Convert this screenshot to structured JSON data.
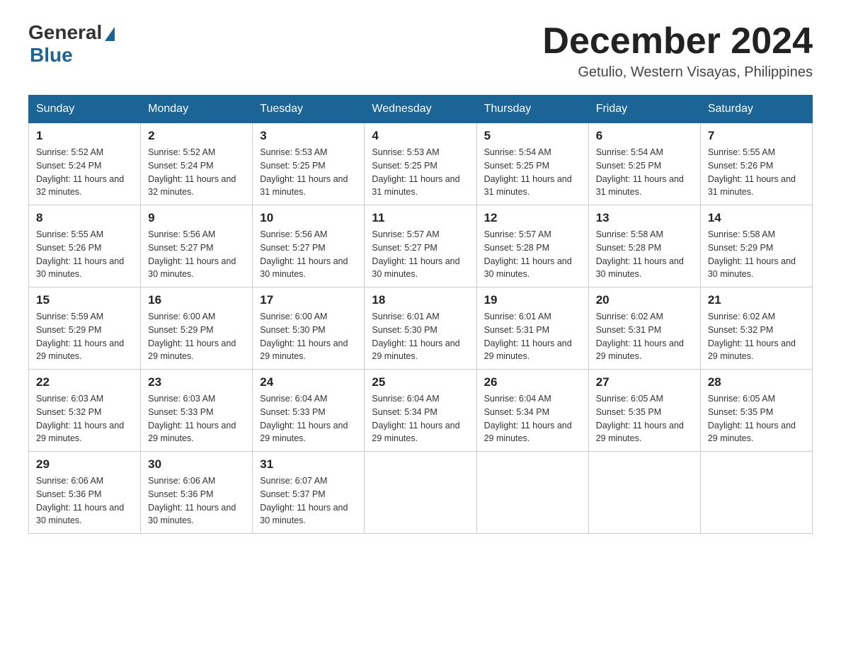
{
  "logo": {
    "general": "General",
    "blue": "Blue"
  },
  "header": {
    "month_year": "December 2024",
    "location": "Getulio, Western Visayas, Philippines"
  },
  "days_of_week": [
    "Sunday",
    "Monday",
    "Tuesday",
    "Wednesday",
    "Thursday",
    "Friday",
    "Saturday"
  ],
  "weeks": [
    [
      {
        "day": "1",
        "sunrise": "5:52 AM",
        "sunset": "5:24 PM",
        "daylight": "11 hours and 32 minutes."
      },
      {
        "day": "2",
        "sunrise": "5:52 AM",
        "sunset": "5:24 PM",
        "daylight": "11 hours and 32 minutes."
      },
      {
        "day": "3",
        "sunrise": "5:53 AM",
        "sunset": "5:25 PM",
        "daylight": "11 hours and 31 minutes."
      },
      {
        "day": "4",
        "sunrise": "5:53 AM",
        "sunset": "5:25 PM",
        "daylight": "11 hours and 31 minutes."
      },
      {
        "day": "5",
        "sunrise": "5:54 AM",
        "sunset": "5:25 PM",
        "daylight": "11 hours and 31 minutes."
      },
      {
        "day": "6",
        "sunrise": "5:54 AM",
        "sunset": "5:25 PM",
        "daylight": "11 hours and 31 minutes."
      },
      {
        "day": "7",
        "sunrise": "5:55 AM",
        "sunset": "5:26 PM",
        "daylight": "11 hours and 31 minutes."
      }
    ],
    [
      {
        "day": "8",
        "sunrise": "5:55 AM",
        "sunset": "5:26 PM",
        "daylight": "11 hours and 30 minutes."
      },
      {
        "day": "9",
        "sunrise": "5:56 AM",
        "sunset": "5:27 PM",
        "daylight": "11 hours and 30 minutes."
      },
      {
        "day": "10",
        "sunrise": "5:56 AM",
        "sunset": "5:27 PM",
        "daylight": "11 hours and 30 minutes."
      },
      {
        "day": "11",
        "sunrise": "5:57 AM",
        "sunset": "5:27 PM",
        "daylight": "11 hours and 30 minutes."
      },
      {
        "day": "12",
        "sunrise": "5:57 AM",
        "sunset": "5:28 PM",
        "daylight": "11 hours and 30 minutes."
      },
      {
        "day": "13",
        "sunrise": "5:58 AM",
        "sunset": "5:28 PM",
        "daylight": "11 hours and 30 minutes."
      },
      {
        "day": "14",
        "sunrise": "5:58 AM",
        "sunset": "5:29 PM",
        "daylight": "11 hours and 30 minutes."
      }
    ],
    [
      {
        "day": "15",
        "sunrise": "5:59 AM",
        "sunset": "5:29 PM",
        "daylight": "11 hours and 29 minutes."
      },
      {
        "day": "16",
        "sunrise": "6:00 AM",
        "sunset": "5:29 PM",
        "daylight": "11 hours and 29 minutes."
      },
      {
        "day": "17",
        "sunrise": "6:00 AM",
        "sunset": "5:30 PM",
        "daylight": "11 hours and 29 minutes."
      },
      {
        "day": "18",
        "sunrise": "6:01 AM",
        "sunset": "5:30 PM",
        "daylight": "11 hours and 29 minutes."
      },
      {
        "day": "19",
        "sunrise": "6:01 AM",
        "sunset": "5:31 PM",
        "daylight": "11 hours and 29 minutes."
      },
      {
        "day": "20",
        "sunrise": "6:02 AM",
        "sunset": "5:31 PM",
        "daylight": "11 hours and 29 minutes."
      },
      {
        "day": "21",
        "sunrise": "6:02 AM",
        "sunset": "5:32 PM",
        "daylight": "11 hours and 29 minutes."
      }
    ],
    [
      {
        "day": "22",
        "sunrise": "6:03 AM",
        "sunset": "5:32 PM",
        "daylight": "11 hours and 29 minutes."
      },
      {
        "day": "23",
        "sunrise": "6:03 AM",
        "sunset": "5:33 PM",
        "daylight": "11 hours and 29 minutes."
      },
      {
        "day": "24",
        "sunrise": "6:04 AM",
        "sunset": "5:33 PM",
        "daylight": "11 hours and 29 minutes."
      },
      {
        "day": "25",
        "sunrise": "6:04 AM",
        "sunset": "5:34 PM",
        "daylight": "11 hours and 29 minutes."
      },
      {
        "day": "26",
        "sunrise": "6:04 AM",
        "sunset": "5:34 PM",
        "daylight": "11 hours and 29 minutes."
      },
      {
        "day": "27",
        "sunrise": "6:05 AM",
        "sunset": "5:35 PM",
        "daylight": "11 hours and 29 minutes."
      },
      {
        "day": "28",
        "sunrise": "6:05 AM",
        "sunset": "5:35 PM",
        "daylight": "11 hours and 29 minutes."
      }
    ],
    [
      {
        "day": "29",
        "sunrise": "6:06 AM",
        "sunset": "5:36 PM",
        "daylight": "11 hours and 30 minutes."
      },
      {
        "day": "30",
        "sunrise": "6:06 AM",
        "sunset": "5:36 PM",
        "daylight": "11 hours and 30 minutes."
      },
      {
        "day": "31",
        "sunrise": "6:07 AM",
        "sunset": "5:37 PM",
        "daylight": "11 hours and 30 minutes."
      },
      null,
      null,
      null,
      null
    ]
  ]
}
